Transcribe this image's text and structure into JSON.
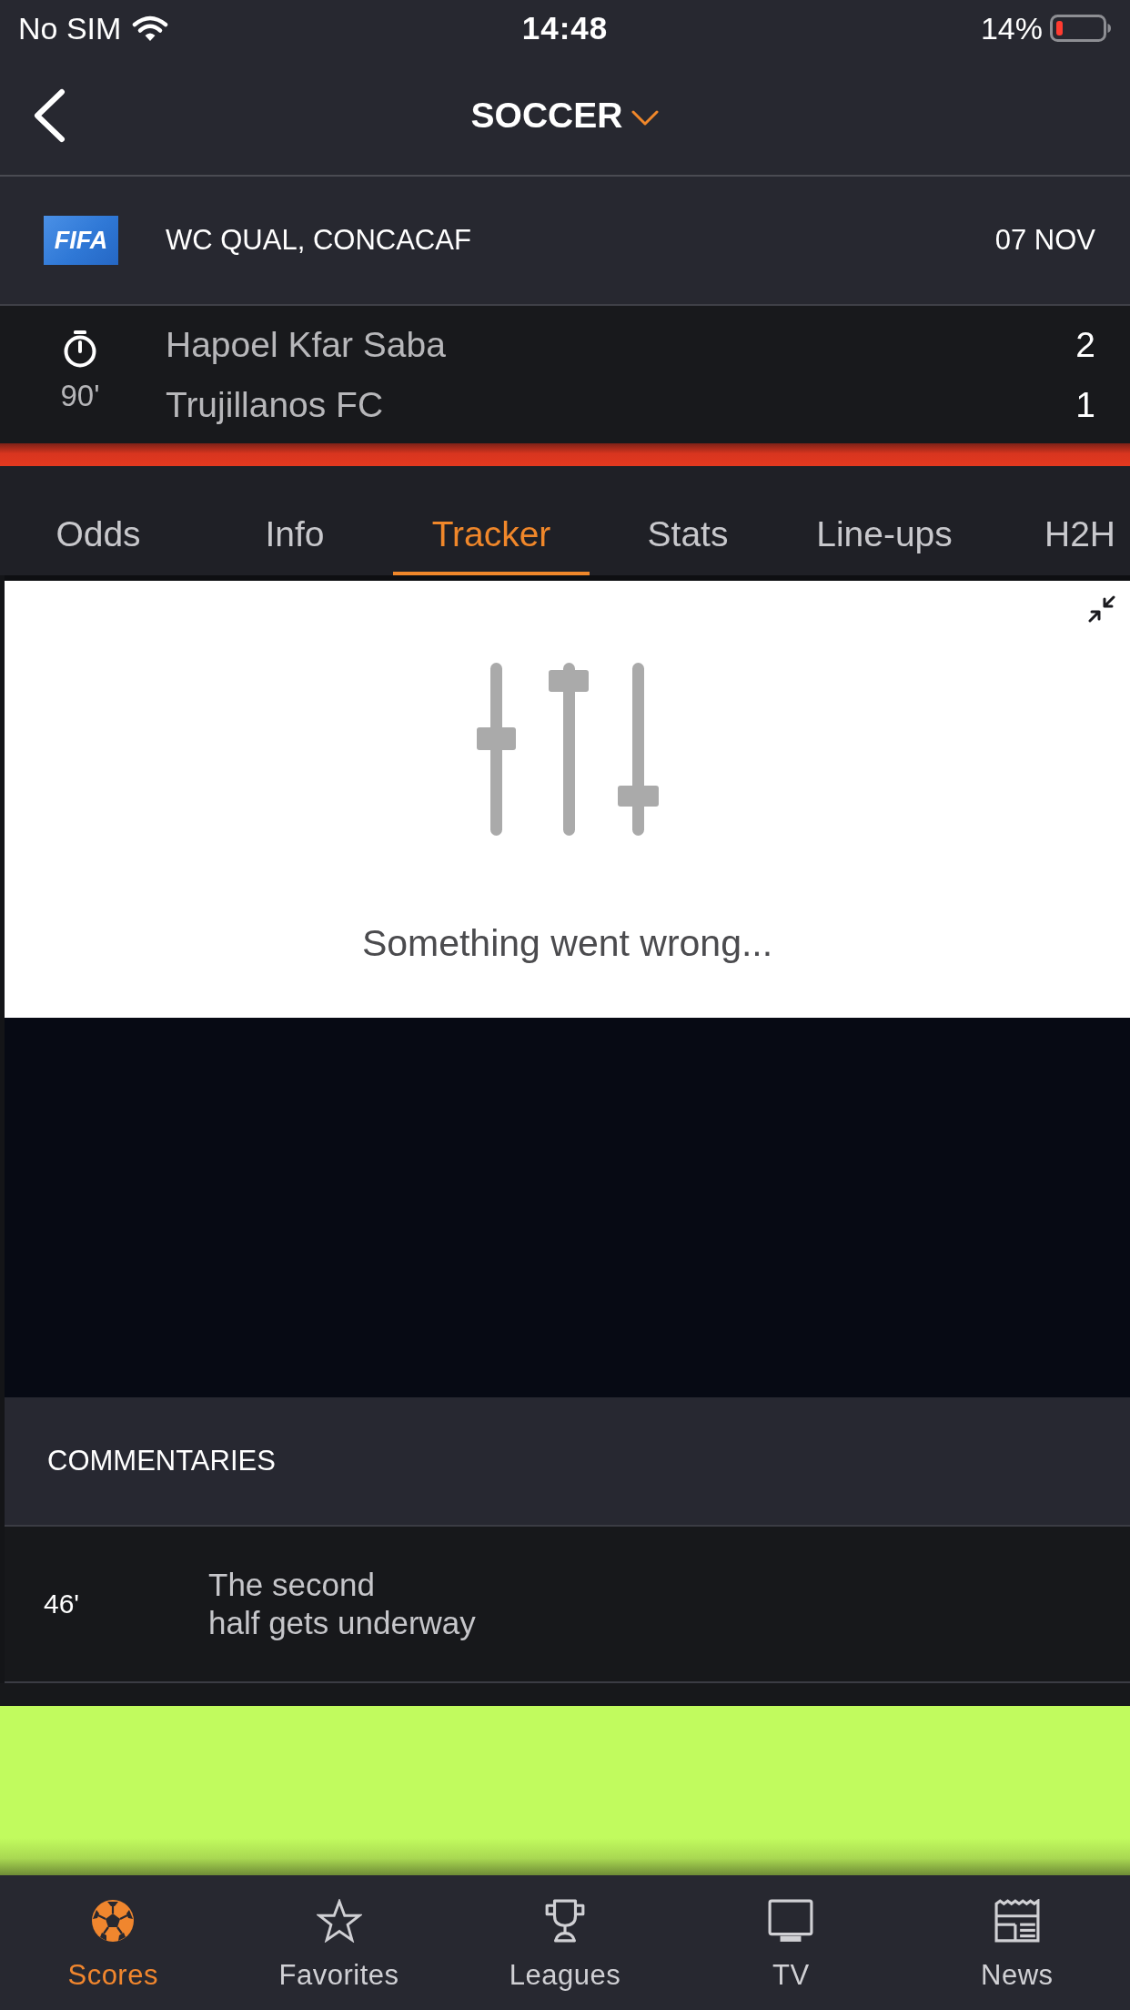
{
  "status_bar": {
    "carrier": "No SIM",
    "time": "14:48",
    "battery": "14%"
  },
  "header": {
    "title": "SOCCER"
  },
  "league": {
    "logo": "FIFA",
    "name": "WC QUAL, CONCACAF",
    "date": "07 NOV"
  },
  "match": {
    "minute": "90'",
    "teams": [
      {
        "name": "Hapoel Kfar Saba",
        "score": "2"
      },
      {
        "name": "Trujillanos FC",
        "score": "1"
      }
    ]
  },
  "tabs": [
    {
      "label": "Odds",
      "selected": false
    },
    {
      "label": "Info",
      "selected": false
    },
    {
      "label": "Tracker",
      "selected": true
    },
    {
      "label": "Stats",
      "selected": false
    },
    {
      "label": "Line-ups",
      "selected": false
    },
    {
      "label": "H2H",
      "selected": false
    }
  ],
  "tracker": {
    "message": "Something went wrong..."
  },
  "commentaries": {
    "title": "COMMENTARIES",
    "entries": [
      {
        "minute": "46'",
        "text": "The second\nhalf gets underway"
      }
    ]
  },
  "bottom_nav": [
    {
      "label": "Scores",
      "kind": "ball",
      "selected": true
    },
    {
      "label": "Favorites",
      "kind": "star",
      "selected": false
    },
    {
      "label": "Leagues",
      "kind": "trophy",
      "selected": false
    },
    {
      "label": "TV",
      "kind": "tv",
      "selected": false
    },
    {
      "label": "News",
      "kind": "news",
      "selected": false
    }
  ]
}
